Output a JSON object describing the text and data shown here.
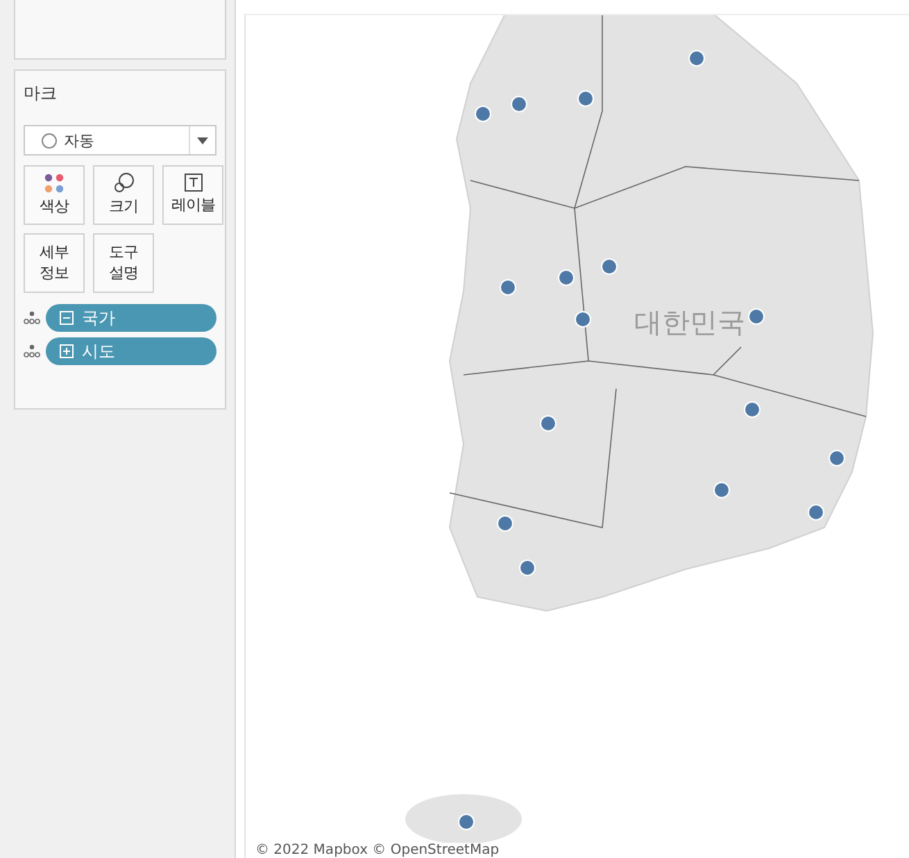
{
  "marks": {
    "title": "마크",
    "mark_type": {
      "value": "자동"
    },
    "cards": [
      {
        "kind": "color",
        "label": "색상"
      },
      {
        "kind": "size",
        "label": "크기"
      },
      {
        "kind": "label",
        "label": "레이블"
      },
      {
        "kind": "detail",
        "label": "세부 정보"
      },
      {
        "kind": "tooltip",
        "label": "도구 설명"
      }
    ],
    "fields": [
      {
        "label": "국가",
        "expanded": true
      },
      {
        "label": "시도",
        "expanded": false
      }
    ]
  },
  "map": {
    "country_label": "대한민국",
    "attribution": "© 2022 Mapbox © OpenStreetMap"
  }
}
